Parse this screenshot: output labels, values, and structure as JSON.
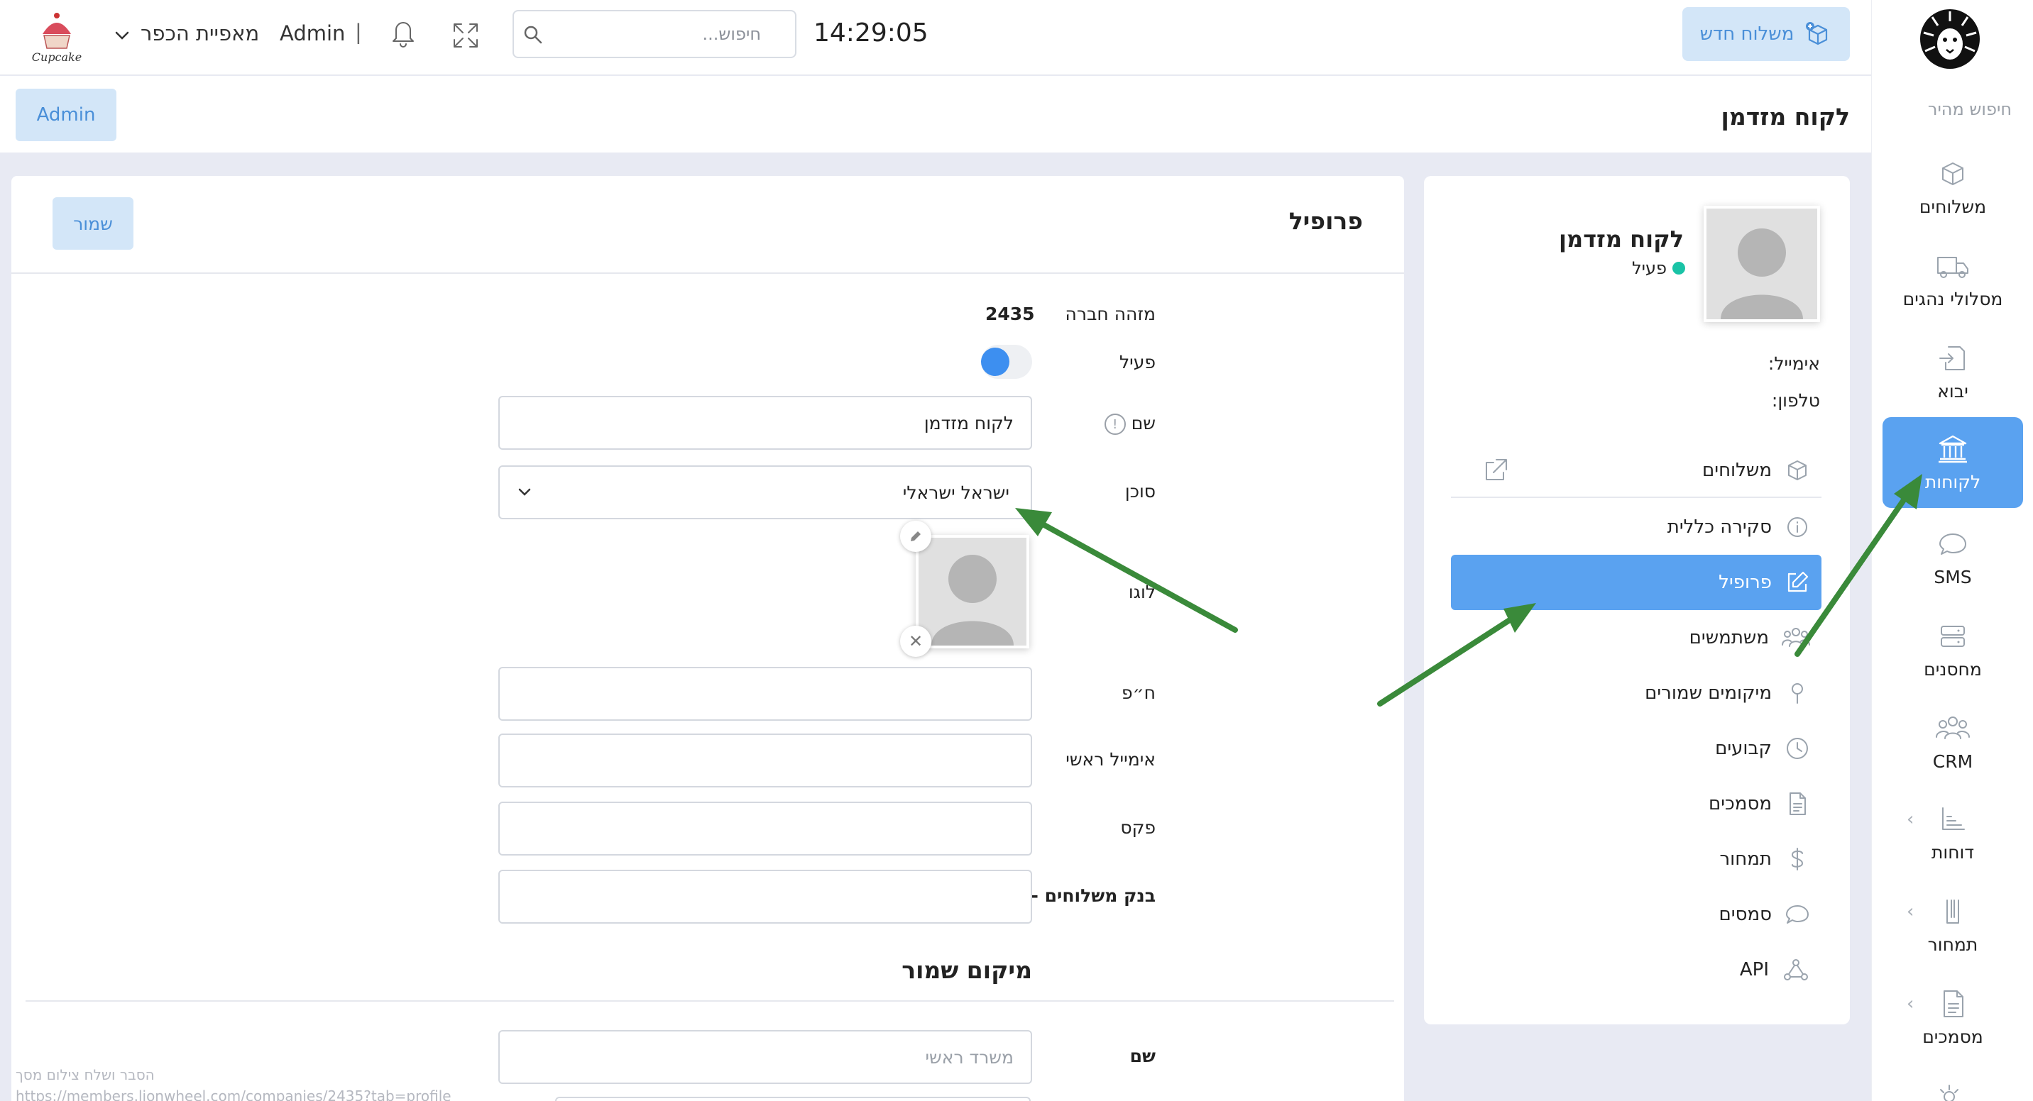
{
  "topbar": {
    "brand": "Cupcake",
    "workspace": "מאפיית הכפר",
    "user": "Admin",
    "separator": "|",
    "search_placeholder": "חיפוש...",
    "clock": "14:29:05",
    "new_shipment": "משלוח חדש"
  },
  "subheader": {
    "admin_chip": "Admin",
    "title": "לקוח מזדמן"
  },
  "sidebar": {
    "quick_search": "חיפוש מהיר",
    "items": [
      {
        "label": "משלוחים",
        "icon": "box-icon"
      },
      {
        "label": "מסלולי נהגים",
        "icon": "truck-icon"
      },
      {
        "label": "יבוא",
        "icon": "import-icon"
      },
      {
        "label": "לקוחות",
        "icon": "bank-icon"
      },
      {
        "label": "SMS",
        "icon": "chat-icon"
      },
      {
        "label": "מחסנים",
        "icon": "server-icon"
      },
      {
        "label": "CRM",
        "icon": "people-icon"
      },
      {
        "label": "דוחות",
        "icon": "chart-icon"
      },
      {
        "label": "תמחור",
        "icon": "pricing-icon"
      },
      {
        "label": "מסמכים",
        "icon": "document-icon"
      }
    ]
  },
  "customer": {
    "name": "לקוח מזדמן",
    "status": "פעיל",
    "email_label": "אימייל:",
    "phone_label": "טלפון:",
    "menu": [
      {
        "label": "משלוחים",
        "icon": "box-icon"
      },
      {
        "label": "סקירה כללית",
        "icon": "info-icon"
      },
      {
        "label": "פרופיל",
        "icon": "edit-icon"
      },
      {
        "label": "משתמשים",
        "icon": "users-icon"
      },
      {
        "label": "מיקומים שמורים",
        "icon": "pin-icon"
      },
      {
        "label": "קבועים",
        "icon": "clock-icon"
      },
      {
        "label": "מסמכים",
        "icon": "document-icon"
      },
      {
        "label": "תמחור",
        "icon": "dollar-icon"
      },
      {
        "label": "סמסים",
        "icon": "chat-icon"
      },
      {
        "label": "API",
        "icon": "webhook-icon"
      }
    ]
  },
  "profile": {
    "title": "פרופיל",
    "save": "שמור",
    "company_id_label": "מזהה חברה",
    "company_id": "2435",
    "active_label": "פעיל",
    "active": true,
    "name_label": "שם",
    "name_value": "לקוח מזדמן",
    "agent_label": "סוכן",
    "agent_value": "ישראל ישראלי",
    "logo_label": "לוגו",
    "vat_label": "ח״פ",
    "vat_value": "",
    "email_label": "אימייל ראשי",
    "email_value": "",
    "fax_label": "פקס",
    "fax_value": "",
    "bank_label": "בנק משלוחים - יתרה",
    "bank_value": "",
    "saved_location_title": "מיקום שמור",
    "saved_name_label": "שם",
    "saved_name_placeholder": "משרד ראשי"
  },
  "status_bar": {
    "hint": "הסבר ושלח צילום מסך",
    "url": "https://members.lionwheel.com/companies/2435?tab=profile"
  },
  "colors": {
    "accent": "#5aa2f0",
    "chip_bg": "#d3e6f8",
    "status_active": "#19c3a6",
    "annotation_arrow": "#3a8a3a"
  }
}
